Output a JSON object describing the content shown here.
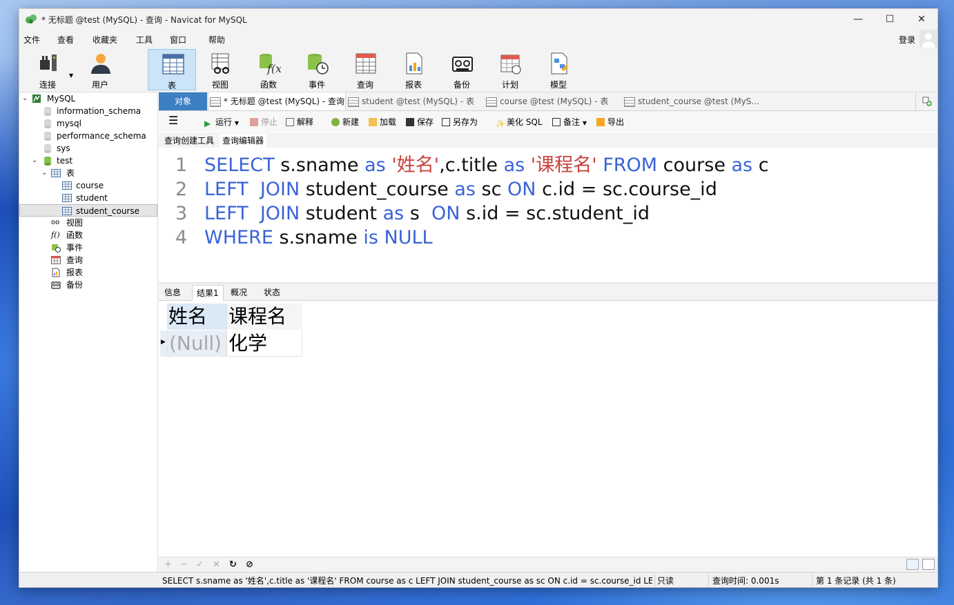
{
  "window": {
    "title": "* 无标题 @test (MySQL) - 查询 - Navicat for MySQL"
  },
  "menu": {
    "items": [
      "文件",
      "查看",
      "收藏夹",
      "工具",
      "窗口",
      "帮助"
    ],
    "login": "登录"
  },
  "toolbar": {
    "buttons": [
      "连接",
      "用户",
      "表",
      "视图",
      "函数",
      "事件",
      "查询",
      "报表",
      "备份",
      "计划",
      "模型"
    ],
    "active": "表"
  },
  "sidebar": {
    "connection": "MySQL",
    "databases": [
      "information_schema",
      "mysql",
      "performance_schema",
      "sys",
      "test"
    ],
    "test_children": {
      "tables_label": "表",
      "tables": [
        "course",
        "student",
        "student_course"
      ],
      "selected_table": "student_course",
      "others": [
        "视图",
        "函数",
        "事件",
        "查询",
        "报表",
        "备份"
      ]
    }
  },
  "tabs": {
    "objects": "对象",
    "items": [
      "* 无标题 @test (MySQL) - 查询",
      "student @test (MySQL) - 表",
      "course @test (MySQL) - 表",
      "student_course @test (MyS..."
    ]
  },
  "query_toolbar": {
    "run": "运行",
    "stop": "停止",
    "explain": "解释",
    "new": "新建",
    "load": "加载",
    "save": "保存",
    "save_as": "另存为",
    "beautify": "美化 SQL",
    "comment": "备注",
    "export": "导出"
  },
  "sub_tabs": [
    "查询创建工具",
    "查询编辑器"
  ],
  "editor": {
    "lines": [
      {
        "n": "1",
        "tokens": [
          [
            "kw",
            "SELECT"
          ],
          [
            "plain",
            " s.sname "
          ],
          [
            "kw",
            "as"
          ],
          [
            "plain",
            " "
          ],
          [
            "str",
            "'姓名'"
          ],
          [
            "plain",
            ",c.title "
          ],
          [
            "kw",
            "as"
          ],
          [
            "plain",
            " "
          ],
          [
            "str",
            "'课程名'"
          ],
          [
            "plain",
            " "
          ],
          [
            "kw",
            "FROM"
          ],
          [
            "plain",
            " course "
          ],
          [
            "kw",
            "as"
          ],
          [
            "plain",
            " c"
          ]
        ]
      },
      {
        "n": "2",
        "tokens": [
          [
            "kw",
            "LEFT  JOIN"
          ],
          [
            "plain",
            " student_course "
          ],
          [
            "kw",
            "as"
          ],
          [
            "plain",
            " sc "
          ],
          [
            "kw",
            "ON"
          ],
          [
            "plain",
            " c.id = sc.course_id"
          ]
        ]
      },
      {
        "n": "3",
        "tokens": [
          [
            "kw",
            "LEFT  JOIN"
          ],
          [
            "plain",
            " student "
          ],
          [
            "kw",
            "as"
          ],
          [
            "plain",
            " s  "
          ],
          [
            "kw",
            "ON"
          ],
          [
            "plain",
            " s.id = sc.student_id"
          ]
        ]
      },
      {
        "n": "4",
        "tokens": [
          [
            "kw",
            "WHERE"
          ],
          [
            "plain",
            " s.sname "
          ],
          [
            "kw",
            "is"
          ],
          [
            "plain",
            " "
          ],
          [
            "kw",
            "NULL"
          ]
        ]
      }
    ]
  },
  "result_tabs": [
    "信息",
    "结果1",
    "概况",
    "状态"
  ],
  "result": {
    "columns": [
      "姓名",
      "课程名"
    ],
    "rows": [
      [
        "(Null)",
        "化学"
      ]
    ]
  },
  "statusbar": {
    "sql": "SELECT s.sname as '姓名',c.title as '课程名' FROM course as c  LEFT  JOIN student_course as sc ON c.id = sc.course_id LEFT",
    "mode": "只读",
    "time": "查询时间: 0.001s",
    "records": "第 1 条记录 (共 1 条)"
  },
  "colors": {
    "keyword": "#3a63d6",
    "string": "#c8423c",
    "objects_tab": "#3c7fc2",
    "active_toolbar": "#cce4f7"
  }
}
